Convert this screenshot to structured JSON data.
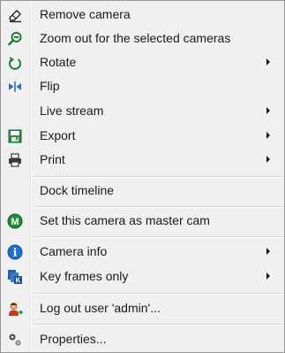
{
  "menu": {
    "items": [
      {
        "label": "Remove camera",
        "icon": "eraser-icon",
        "submenu": false
      },
      {
        "label": "Zoom out for the selected cameras",
        "icon": "zoom-out-icon",
        "submenu": false
      },
      {
        "label": "Rotate",
        "icon": "rotate-icon",
        "submenu": true
      },
      {
        "label": "Flip",
        "icon": "flip-icon",
        "submenu": false
      },
      {
        "label": "Live stream",
        "icon": "",
        "submenu": true
      },
      {
        "label": "Export",
        "icon": "export-icon",
        "submenu": true
      },
      {
        "label": "Print",
        "icon": "printer-icon",
        "submenu": true
      },
      {
        "label": "Dock timeline",
        "icon": "",
        "submenu": false
      },
      {
        "label": "Set this camera as master cam",
        "icon": "master-cam-icon",
        "submenu": false
      },
      {
        "label": "Camera info",
        "icon": "info-icon",
        "submenu": true
      },
      {
        "label": "Key frames only",
        "icon": "key-frames-icon",
        "submenu": true
      },
      {
        "label": "Log out user 'admin'...",
        "icon": "user-logout-icon",
        "submenu": false
      },
      {
        "label": "Properties...",
        "icon": "properties-icon",
        "submenu": false
      }
    ],
    "master_badge": "M",
    "info_badge": "i",
    "key_badge": "K"
  },
  "colors": {
    "menu_bg": "#f0f0f0",
    "border": "#979797",
    "master_green": "#1e8a3a",
    "info_blue": "#1f6fd1"
  }
}
